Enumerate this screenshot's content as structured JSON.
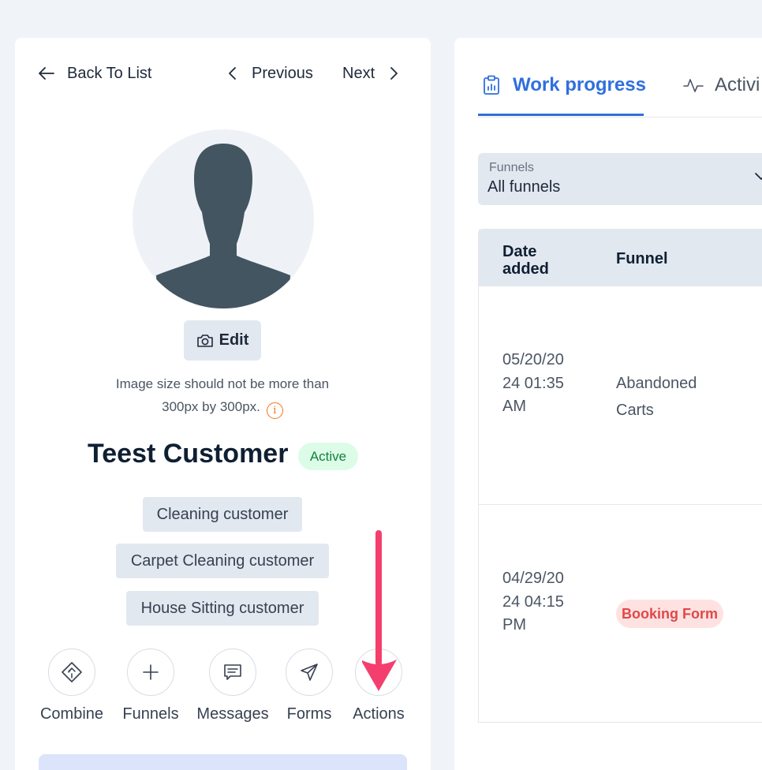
{
  "nav": {
    "back_label": "Back To List",
    "previous_label": "Previous",
    "next_label": "Next"
  },
  "profile": {
    "edit_label": "Edit",
    "image_note_line1": "Image size should not be more than",
    "image_note_line2": "300px by 300px.",
    "info_glyph": "i",
    "name": "Teest Customer",
    "status": "Active"
  },
  "tags": [
    "Cleaning customer",
    "Carpet Cleaning customer",
    "House Sitting customer"
  ],
  "actions": {
    "combine": "Combine",
    "funnels": "Funnels",
    "messages": "Messages",
    "forms": "Forms",
    "actions": "Actions"
  },
  "right_panel": {
    "tabs": {
      "work_progress": "Work progress",
      "activity": "Activi"
    },
    "funnel_select": {
      "label": "Funnels",
      "value": "All funnels"
    },
    "table": {
      "headers": {
        "date": "Date added",
        "funnel": "Funnel"
      },
      "rows": [
        {
          "date": "05/20/2024 01:35 AM",
          "funnel": "Abandoned Carts"
        },
        {
          "date": "04/29/2024 04:15 PM",
          "funnel": "Booking Form"
        }
      ]
    }
  },
  "colors": {
    "accent": "#2f6fde",
    "annotation_arrow": "#f43f6e",
    "status_active_bg": "#dcfce7",
    "status_active_text": "#15803d",
    "booking_badge_bg": "#fee2e2",
    "booking_badge_text": "#e04848"
  },
  "icons": {
    "back": "arrow-left-icon",
    "previous": "chevron-left-icon",
    "next": "chevron-right-icon",
    "edit": "camera-icon",
    "info": "info-icon",
    "combine": "merge-icon",
    "funnels": "plus-icon",
    "messages": "message-icon",
    "forms": "send-icon",
    "actions": "more-vertical-icon",
    "work_progress": "clipboard-icon",
    "activity": "activity-icon",
    "select": "chevron-down-icon"
  }
}
